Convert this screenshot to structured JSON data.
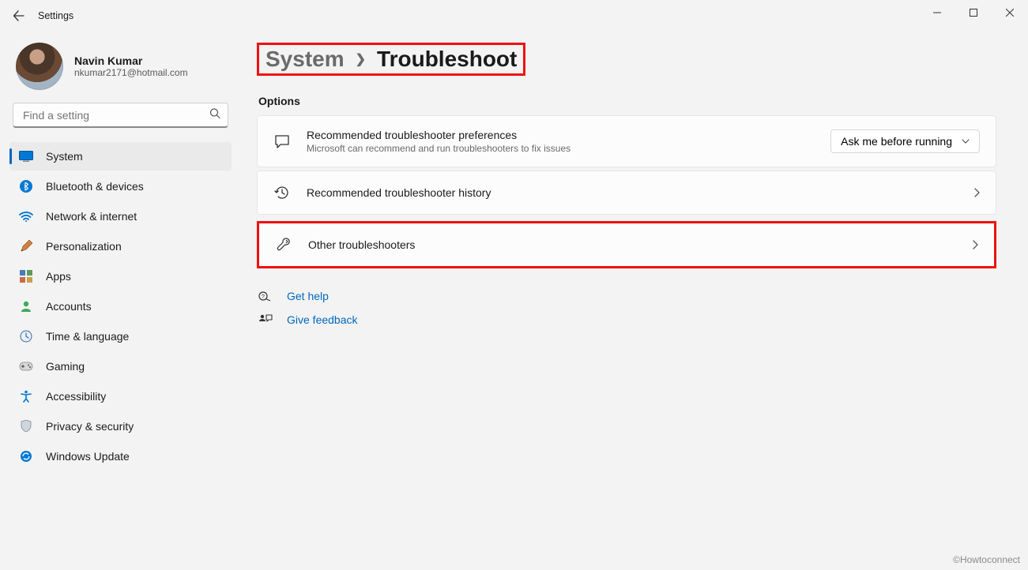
{
  "app": {
    "title": "Settings"
  },
  "user": {
    "name": "Navin Kumar",
    "email": "nkumar2171@hotmail.com"
  },
  "search": {
    "placeholder": "Find a setting"
  },
  "nav": {
    "items": [
      {
        "label": "System",
        "active": true
      },
      {
        "label": "Bluetooth & devices"
      },
      {
        "label": "Network & internet"
      },
      {
        "label": "Personalization"
      },
      {
        "label": "Apps"
      },
      {
        "label": "Accounts"
      },
      {
        "label": "Time & language"
      },
      {
        "label": "Gaming"
      },
      {
        "label": "Accessibility"
      },
      {
        "label": "Privacy & security"
      },
      {
        "label": "Windows Update"
      }
    ]
  },
  "breadcrumb": {
    "parent": "System",
    "current": "Troubleshoot"
  },
  "section": {
    "title": "Options"
  },
  "cards": {
    "rec_pref": {
      "title": "Recommended troubleshooter preferences",
      "subtitle": "Microsoft can recommend and run troubleshooters to fix issues",
      "dropdown_value": "Ask me before running"
    },
    "rec_history": {
      "title": "Recommended troubleshooter history"
    },
    "other": {
      "title": "Other troubleshooters"
    }
  },
  "help": {
    "get_help": "Get help",
    "feedback": "Give feedback"
  },
  "watermark": "©Howtoconnect"
}
